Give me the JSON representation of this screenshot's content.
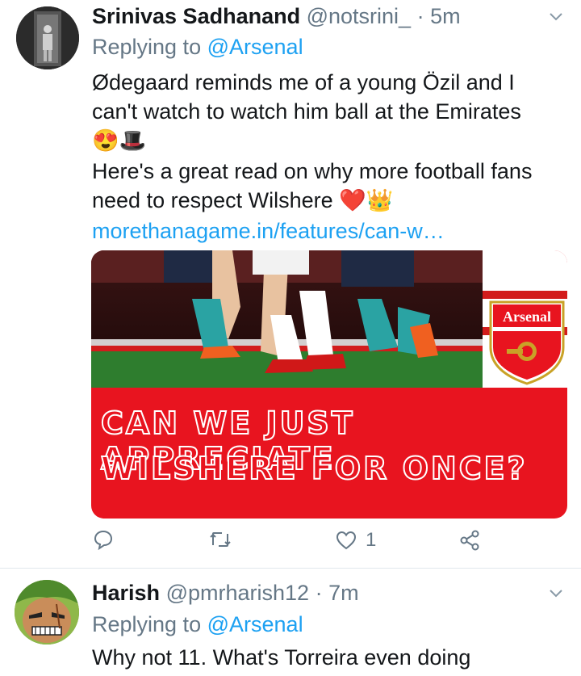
{
  "tweets": [
    {
      "display_name": "Srinivas Sadhanand",
      "handle": "@notsrini_",
      "separator": "·",
      "time": "5m",
      "replying_prefix": "Replying to",
      "replying_to": "@Arsenal",
      "text_lines": [
        "Ødegaard reminds me of a young Özil and I",
        "can't watch to watch him ball at the Emirates",
        "😍🎩",
        "Here's a great read on why more football fans",
        "need to respect Wilshere ❤️👑"
      ],
      "link": "morethanagame.in/features/can-w…",
      "card": {
        "badge_label": "Arsenal",
        "headline_line1": "CAN WE JUST APPRECIATE",
        "headline_line2": "WILSHERE FOR ONCE?"
      },
      "actions": {
        "reply_icon": "reply-icon",
        "retweet_icon": "retweet-icon",
        "like_icon": "heart-icon",
        "like_count": "1",
        "share_icon": "share-icon"
      }
    },
    {
      "display_name": "Harish",
      "handle": "@pmrharish12",
      "separator": "·",
      "time": "7m",
      "replying_prefix": "Replying to",
      "replying_to": "@Arsenal",
      "text_lines": [
        "Why not 11. What's Torreira even doing"
      ]
    }
  ],
  "colors": {
    "link": "#1da1f2",
    "muted": "#657786",
    "arsenal_red": "#e8141f"
  }
}
